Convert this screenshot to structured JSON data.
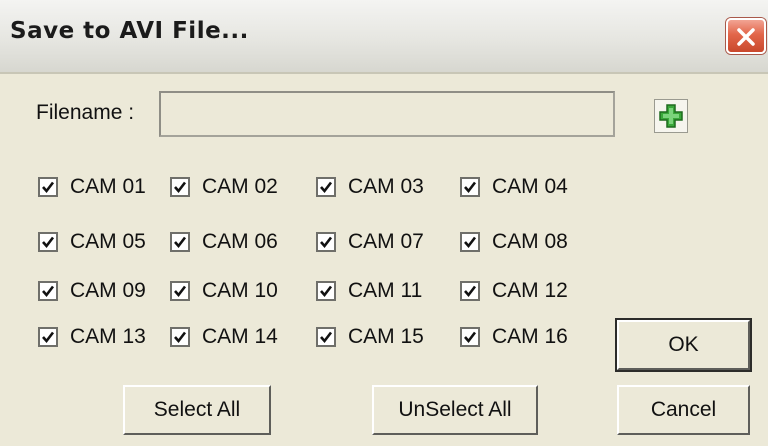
{
  "window": {
    "title": "Save to AVI File..."
  },
  "filename": {
    "label": "Filename :",
    "value": ""
  },
  "cameras": [
    {
      "label": "CAM 01",
      "checked": true
    },
    {
      "label": "CAM 02",
      "checked": true
    },
    {
      "label": "CAM 03",
      "checked": true
    },
    {
      "label": "CAM 04",
      "checked": true
    },
    {
      "label": "CAM 05",
      "checked": true
    },
    {
      "label": "CAM 06",
      "checked": true
    },
    {
      "label": "CAM 07",
      "checked": true
    },
    {
      "label": "CAM 08",
      "checked": true
    },
    {
      "label": "CAM 09",
      "checked": true
    },
    {
      "label": "CAM 10",
      "checked": true
    },
    {
      "label": "CAM 11",
      "checked": true
    },
    {
      "label": "CAM 12",
      "checked": true
    },
    {
      "label": "CAM 13",
      "checked": true
    },
    {
      "label": "CAM 14",
      "checked": true
    },
    {
      "label": "CAM 15",
      "checked": true
    },
    {
      "label": "CAM 16",
      "checked": true
    }
  ],
  "buttons": {
    "ok": "OK",
    "cancel": "Cancel",
    "select_all": "Select All",
    "unselect_all": "UnSelect All"
  },
  "colors": {
    "dialog_bg": "#ece9d8",
    "close_red": "#e2664a",
    "add_green": "#3aa83a"
  }
}
